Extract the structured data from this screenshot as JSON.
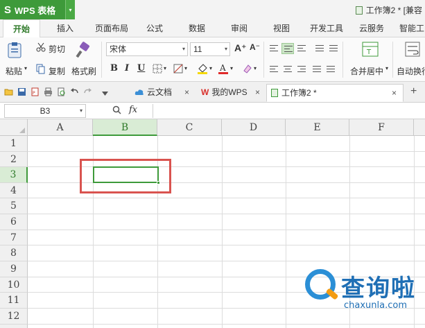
{
  "titlebar": {
    "app_name": "WPS 表格",
    "app_logo": "S",
    "dropdown": "▾",
    "document_title": "工作簿2 * [兼容"
  },
  "menu": {
    "items": [
      "开始",
      "插入",
      "页面布局",
      "公式",
      "数据",
      "审阅",
      "视图",
      "开发工具",
      "云服务",
      "智能工"
    ],
    "active": "开始"
  },
  "ribbon": {
    "paste": "粘贴",
    "cut": "剪切",
    "copy": "复制",
    "format_painter": "格式刷",
    "font_name": "宋体",
    "font_size": "11",
    "grow_font": "A⁺",
    "shrink_font": "A⁻",
    "bold": "B",
    "italic": "I",
    "underline": "U",
    "merge_center": "合并居中",
    "auto_wrap": "自动换行",
    "dropdown": "▾"
  },
  "quickbar": {
    "tabs": [
      {
        "label": "云文档",
        "icon": "cloud-icon"
      },
      {
        "label": "我的WPS",
        "icon": "wps-logo-icon"
      },
      {
        "label": "工作簿2 *",
        "icon": "spreadsheet-icon",
        "active": true
      }
    ],
    "close": "×",
    "new_tab": "+"
  },
  "formulabar": {
    "cell_ref": "B3",
    "fx": "fx",
    "dropdown": "▾",
    "formula_value": ""
  },
  "sheet": {
    "columns": [
      "A",
      "B",
      "C",
      "D",
      "E",
      "F"
    ],
    "rows": [
      "1",
      "2",
      "3",
      "4",
      "5",
      "6",
      "7",
      "8",
      "9",
      "10",
      "11",
      "12"
    ],
    "selected_column": "B",
    "selected_row": "3",
    "active_cell": "B3"
  },
  "watermark": {
    "brand": "查询啦",
    "url": "chaxunla.com"
  },
  "colors": {
    "accent_green": "#3e9a3a",
    "highlight_red": "#d9534f",
    "watermark_blue": "#1f6fb5"
  }
}
